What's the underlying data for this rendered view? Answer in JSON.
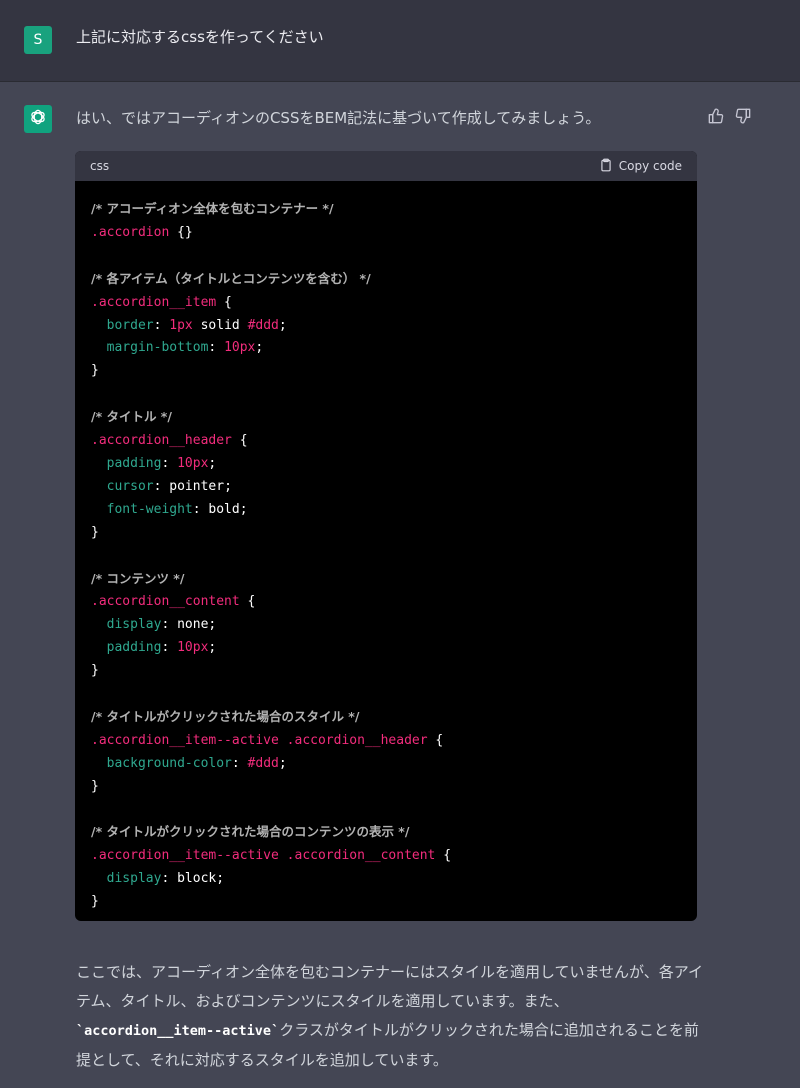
{
  "user": {
    "avatar_letter": "S",
    "message": "上記に対応するcssを作ってください"
  },
  "assistant": {
    "intro": "はい、ではアコーディオンのCSSをBEM記法に基づいて作成してみましょう。",
    "code_block": {
      "language": "css",
      "copy_label": "Copy code",
      "lines": [
        [
          {
            "t": "cm",
            "v": "/* アコーディオン全体を包むコンテナー */"
          }
        ],
        [
          {
            "t": "sel",
            "v": ".accordion"
          },
          {
            "t": "val",
            "v": " {}"
          }
        ],
        [],
        [
          {
            "t": "cm",
            "v": "/* 各アイテム（タイトルとコンテンツを含む） */"
          }
        ],
        [
          {
            "t": "sel",
            "v": ".accordion__item"
          },
          {
            "t": "val",
            "v": " {"
          }
        ],
        [
          {
            "t": "val",
            "v": "  "
          },
          {
            "t": "prop",
            "v": "border"
          },
          {
            "t": "val",
            "v": ": "
          },
          {
            "t": "num",
            "v": "1px"
          },
          {
            "t": "val",
            "v": " solid "
          },
          {
            "t": "hex",
            "v": "#ddd"
          },
          {
            "t": "val",
            "v": ";"
          }
        ],
        [
          {
            "t": "val",
            "v": "  "
          },
          {
            "t": "prop",
            "v": "margin-bottom"
          },
          {
            "t": "val",
            "v": ": "
          },
          {
            "t": "num",
            "v": "10px"
          },
          {
            "t": "val",
            "v": ";"
          }
        ],
        [
          {
            "t": "val",
            "v": "}"
          }
        ],
        [],
        [
          {
            "t": "cm",
            "v": "/* タイトル */"
          }
        ],
        [
          {
            "t": "sel",
            "v": ".accordion__header"
          },
          {
            "t": "val",
            "v": " {"
          }
        ],
        [
          {
            "t": "val",
            "v": "  "
          },
          {
            "t": "prop",
            "v": "padding"
          },
          {
            "t": "val",
            "v": ": "
          },
          {
            "t": "num",
            "v": "10px"
          },
          {
            "t": "val",
            "v": ";"
          }
        ],
        [
          {
            "t": "val",
            "v": "  "
          },
          {
            "t": "prop",
            "v": "cursor"
          },
          {
            "t": "val",
            "v": ": pointer;"
          }
        ],
        [
          {
            "t": "val",
            "v": "  "
          },
          {
            "t": "prop",
            "v": "font-weight"
          },
          {
            "t": "val",
            "v": ": bold;"
          }
        ],
        [
          {
            "t": "val",
            "v": "}"
          }
        ],
        [],
        [
          {
            "t": "cm",
            "v": "/* コンテンツ */"
          }
        ],
        [
          {
            "t": "sel",
            "v": ".accordion__content"
          },
          {
            "t": "val",
            "v": " {"
          }
        ],
        [
          {
            "t": "val",
            "v": "  "
          },
          {
            "t": "prop",
            "v": "display"
          },
          {
            "t": "val",
            "v": ": none;"
          }
        ],
        [
          {
            "t": "val",
            "v": "  "
          },
          {
            "t": "prop",
            "v": "padding"
          },
          {
            "t": "val",
            "v": ": "
          },
          {
            "t": "num",
            "v": "10px"
          },
          {
            "t": "val",
            "v": ";"
          }
        ],
        [
          {
            "t": "val",
            "v": "}"
          }
        ],
        [],
        [
          {
            "t": "cm",
            "v": "/* タイトルがクリックされた場合のスタイル */"
          }
        ],
        [
          {
            "t": "sel",
            "v": ".accordion__item--active .accordion__header"
          },
          {
            "t": "val",
            "v": " {"
          }
        ],
        [
          {
            "t": "val",
            "v": "  "
          },
          {
            "t": "prop",
            "v": "background-color"
          },
          {
            "t": "val",
            "v": ": "
          },
          {
            "t": "hex",
            "v": "#ddd"
          },
          {
            "t": "val",
            "v": ";"
          }
        ],
        [
          {
            "t": "val",
            "v": "}"
          }
        ],
        [],
        [
          {
            "t": "cm",
            "v": "/* タイトルがクリックされた場合のコンテンツの表示 */"
          }
        ],
        [
          {
            "t": "sel",
            "v": ".accordion__item--active .accordion__content"
          },
          {
            "t": "val",
            "v": " {"
          }
        ],
        [
          {
            "t": "val",
            "v": "  "
          },
          {
            "t": "prop",
            "v": "display"
          },
          {
            "t": "val",
            "v": ": block;"
          }
        ],
        [
          {
            "t": "val",
            "v": "}"
          }
        ]
      ]
    },
    "after": {
      "part1": "ここでは、アコーディオン全体を包むコンテナーにはスタイルを適用していませんが、各アイテム、タイトル、およびコンテンツにスタイルを適用しています。また、",
      "code": "`accordion__item--active`",
      "part2": "クラスがタイトルがクリックされた場合に追加されることを前提として、それに対応するスタイルを追加しています。"
    }
  },
  "icons": {
    "thumbs_up": "thumbs-up-icon",
    "thumbs_down": "thumbs-down-icon",
    "clipboard": "clipboard-icon",
    "openai_logo": "openai-logo-icon"
  }
}
